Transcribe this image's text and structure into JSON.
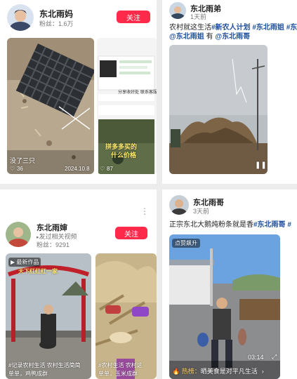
{
  "c1": {
    "name": "东北雨妈",
    "fans_label": "粉丝：1.6万",
    "follow_label": "关注",
    "video1": {
      "caption": "没了三只",
      "likes": "36",
      "date": "2024.10.8"
    },
    "video2": {
      "likes": "87",
      "mini": [
        "分享收好处",
        "联系客服"
      ],
      "overlay": "拼多多买的",
      "overlay2": "什么价格"
    }
  },
  "c2": {
    "name": "东北雨弟",
    "time": "1天前",
    "text_line1": "农村就这生活",
    "tags_line1": [
      "#新农人计划",
      "#东北雨姐",
      "#东北雨"
    ],
    "tags_line2_prefix": "@东北雨姐",
    "line2_mid": " 有",
    "tags_line2_suffix": "@东北雨哥"
  },
  "c3": {
    "name": "东北雨婶",
    "status": "发过相关视频",
    "fans_label": "粉丝：9291",
    "follow_label": "关注",
    "video1": {
      "badge": "最新作品",
      "arch": "天下红红红一家",
      "caption1": "#记录农村生活",
      "caption2": "农村生活简简",
      "caption3": "单单",
      "caption4": "鸡鸭成群"
    },
    "video2": {
      "caption1": "#农村生活",
      "caption2": "农村这",
      "caption3": "单单",
      "caption4": "玉米成群"
    }
  },
  "c4": {
    "name": "东北雨哥",
    "time": "3天前",
    "text": "正宗东北大鹅炖粉条就是香",
    "tag1": "#东北雨哥",
    "tag2": "#",
    "badge": "点赞飙升",
    "duration": "03:14",
    "hot_prefix": "热榜：",
    "hot_text": "晒美食是对平凡生活",
    "hot_arrow": "›"
  },
  "colors": {
    "accent": "#ff2a4a",
    "tag": "#1d4f9c"
  }
}
